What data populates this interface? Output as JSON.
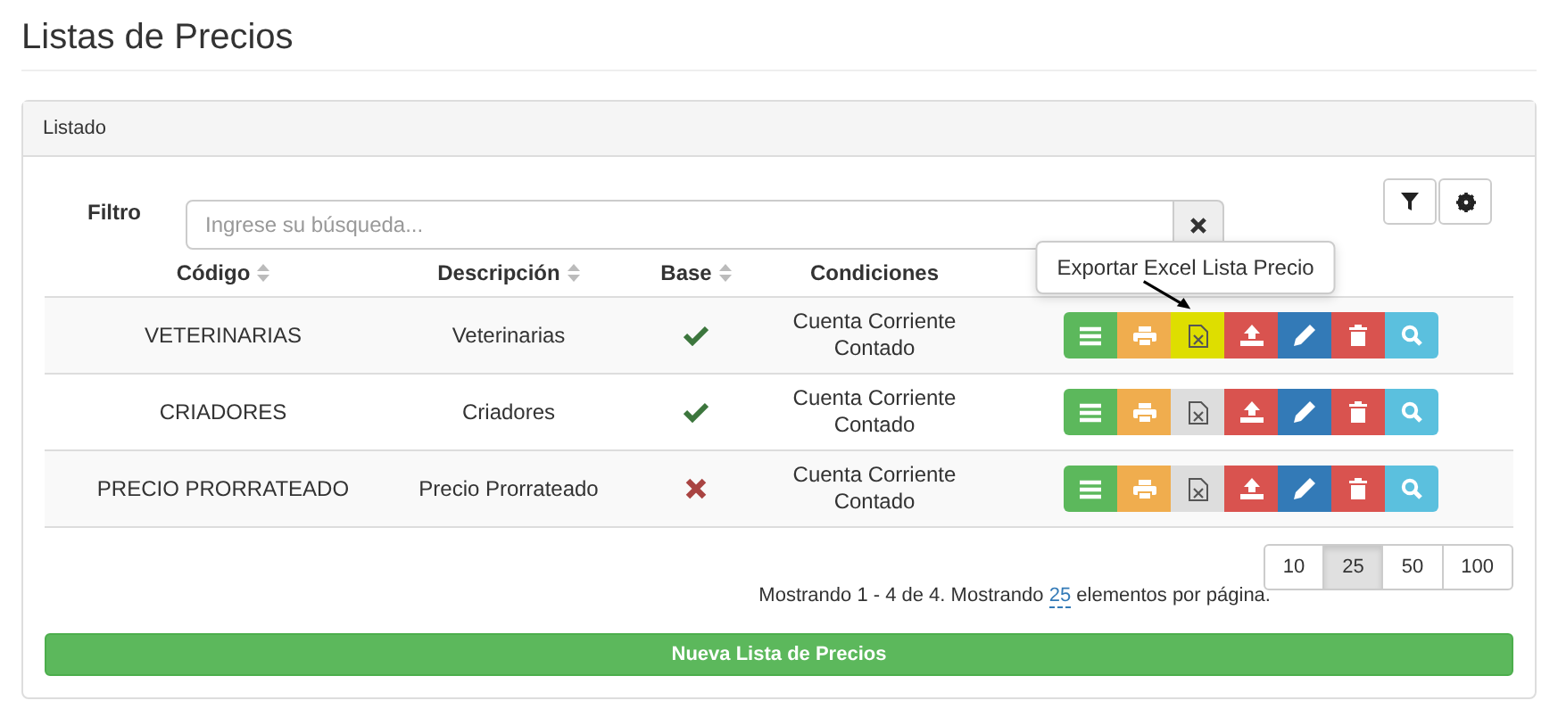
{
  "page_title": "Listas de Precios",
  "panel": {
    "title": "Listado"
  },
  "filter": {
    "label": "Filtro",
    "placeholder": "Ingrese su búsqueda..."
  },
  "columns": [
    {
      "label": "Código",
      "sortable": true
    },
    {
      "label": "Descripción",
      "sortable": true
    },
    {
      "label": "Base",
      "sortable": true
    },
    {
      "label": "Condiciones",
      "sortable": false
    }
  ],
  "rows": [
    {
      "code": "VETERINARIAS",
      "description": "Veterinarias",
      "base": true,
      "conditions": [
        "Cuenta Corriente",
        "Contado"
      ],
      "actions": [
        {
          "kind": "list"
        },
        {
          "kind": "print"
        },
        {
          "kind": "excel",
          "highlighted": true,
          "tooltip": "Exportar Excel Lista Precio"
        },
        {
          "kind": "upload"
        },
        {
          "kind": "edit"
        },
        {
          "kind": "delete"
        },
        {
          "kind": "view"
        }
      ]
    },
    {
      "code": "CRIADORES",
      "description": "Criadores",
      "base": true,
      "conditions": [
        "Cuenta Corriente",
        "Contado"
      ],
      "actions": [
        {
          "kind": "list"
        },
        {
          "kind": "print"
        },
        {
          "kind": "excel",
          "highlighted": false
        },
        {
          "kind": "upload"
        },
        {
          "kind": "edit"
        },
        {
          "kind": "delete"
        },
        {
          "kind": "view"
        }
      ]
    },
    {
      "code": "PRECIO PRORRATEADO",
      "description": "Precio Prorrateado",
      "base": false,
      "conditions": [
        "Cuenta Corriente",
        "Contado"
      ],
      "actions": [
        {
          "kind": "list"
        },
        {
          "kind": "print"
        },
        {
          "kind": "excel",
          "highlighted": false
        },
        {
          "kind": "upload"
        },
        {
          "kind": "edit"
        },
        {
          "kind": "delete"
        },
        {
          "kind": "view"
        }
      ]
    }
  ],
  "page_sizes": [
    {
      "label": "10",
      "selected": false
    },
    {
      "label": "25",
      "selected": true
    },
    {
      "label": "50",
      "selected": false
    },
    {
      "label": "100",
      "selected": false
    }
  ],
  "summary": {
    "before": "Mostrando 1 - 4 de 4. Mostrando",
    "link": "25",
    "after": "elementos por página."
  },
  "new_button": "Nueva Lista de Precios"
}
